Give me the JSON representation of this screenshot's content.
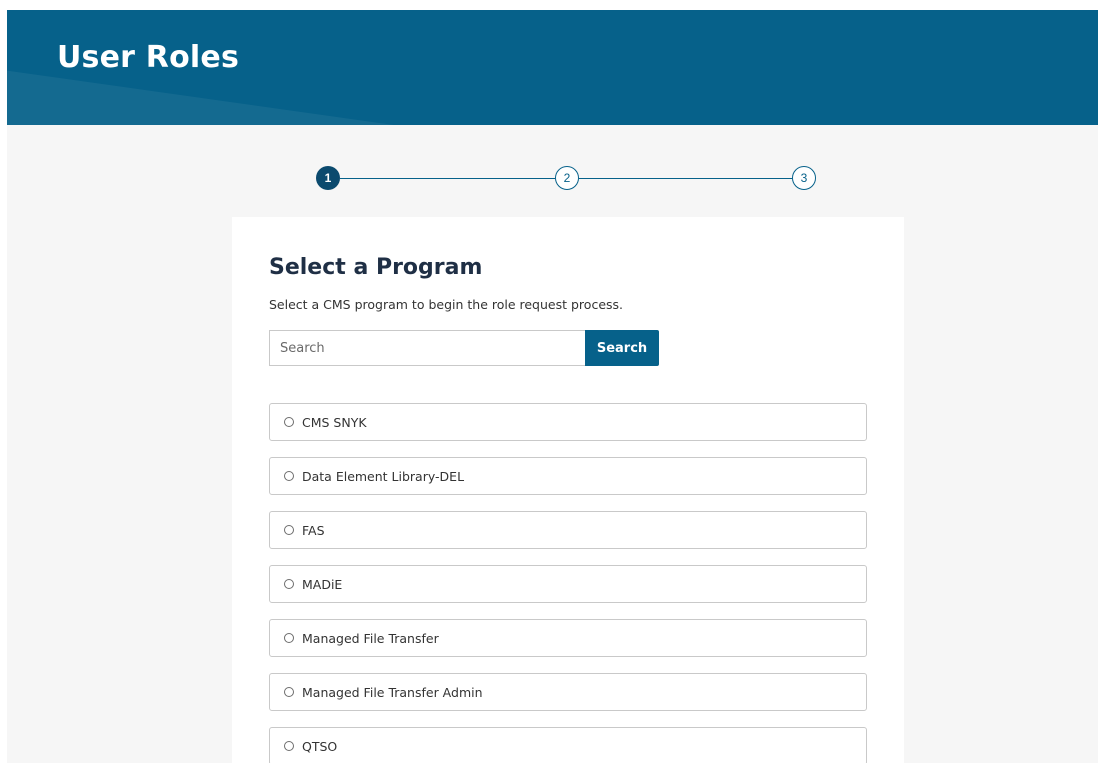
{
  "header": {
    "title": "User Roles"
  },
  "stepper": {
    "steps": [
      "1",
      "2",
      "3"
    ],
    "active_step": 1
  },
  "main": {
    "heading": "Select a Program",
    "subtitle": "Select a CMS program to begin the role request process.",
    "search": {
      "placeholder": "Search",
      "value": "",
      "button_label": "Search"
    },
    "programs": [
      {
        "label": "CMS SNYK",
        "selected": false
      },
      {
        "label": "Data Element Library-DEL",
        "selected": false
      },
      {
        "label": "FAS",
        "selected": false
      },
      {
        "label": "MADiE",
        "selected": false
      },
      {
        "label": "Managed File Transfer",
        "selected": false
      },
      {
        "label": "Managed File Transfer Admin",
        "selected": false
      },
      {
        "label": "QTSO",
        "selected": false
      }
    ]
  },
  "colors": {
    "brand": "#06618a",
    "active_step": "#0b4a6e",
    "background": "#f6f6f6",
    "heading": "#1f2f45"
  }
}
